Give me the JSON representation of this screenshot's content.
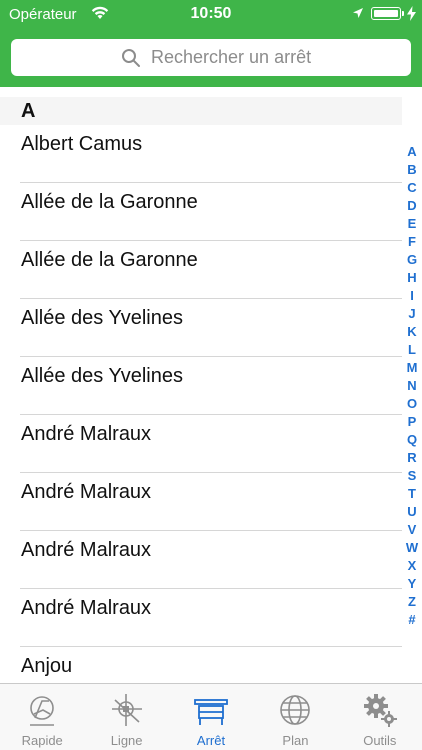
{
  "status_bar": {
    "carrier": "Opérateur",
    "time": "10:50"
  },
  "search": {
    "placeholder": "Rechercher un arrêt"
  },
  "section": {
    "letter": "A"
  },
  "stops": [
    "Albert Camus",
    "Allée de la Garonne",
    "Allée de la Garonne",
    "Allée des Yvelines",
    "Allée des Yvelines",
    "André Malraux",
    "André Malraux",
    "André Malraux",
    "André Malraux",
    "Anjou"
  ],
  "index_letters": [
    "A",
    "B",
    "C",
    "D",
    "E",
    "F",
    "G",
    "H",
    "I",
    "J",
    "K",
    "L",
    "M",
    "N",
    "O",
    "P",
    "Q",
    "R",
    "S",
    "T",
    "U",
    "V",
    "W",
    "X",
    "Y",
    "Z",
    "#"
  ],
  "tabs": [
    {
      "label": "Rapide",
      "icon": "rapide-icon",
      "active": false
    },
    {
      "label": "Ligne",
      "icon": "ligne-icon",
      "active": false
    },
    {
      "label": "Arrêt",
      "icon": "arret-icon",
      "active": true
    },
    {
      "label": "Plan",
      "icon": "plan-icon",
      "active": false
    },
    {
      "label": "Outils",
      "icon": "outils-icon",
      "active": false
    }
  ],
  "colors": {
    "header_green": "#3fb549",
    "accent_blue": "#1f6fd0",
    "inactive_gray": "#8e8e8e"
  }
}
